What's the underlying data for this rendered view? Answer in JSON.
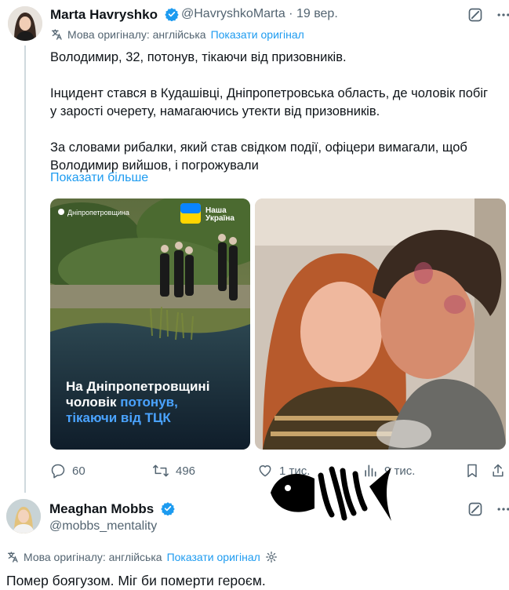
{
  "tweet1": {
    "author_name": "Marta Havryshko",
    "author_handle": "@HavryshkoMarta",
    "separator": "·",
    "date": "19 вер.",
    "translation_note": "Мова оригіналу: англійська",
    "show_original": "Показати оригінал",
    "paragraphs": [
      "Володимир, 32, потонув, тікаючи від призовників.",
      "Інцидент стався в Кудашівці, Дніпропетровська область, де чоловік побіг у зарості очерету, намагаючись утекти від призовників.",
      "За словами рибалки, який став свідком події, офіцери вимагали, щоб Володимир вийшов, і погрожували"
    ],
    "show_more": "Показати більше",
    "media1": {
      "location_label": "Дніпропетровщина",
      "badge_line1": "Наша",
      "badge_line2": "Україна",
      "headline_line1": "На Дніпропетровщині",
      "headline_line2_white": "чоловік ",
      "headline_line2_blue": "потонув,",
      "headline_line3": "тікаючи від ТЦК"
    },
    "stats": {
      "replies": "60",
      "retweets": "496",
      "likes": "1 тис.",
      "views": "9 тис."
    }
  },
  "tweet2": {
    "author_name": "Meaghan Mobbs",
    "author_handle": "@mobbs_mentality",
    "translation_note": "Мова оригіналу: англійська",
    "show_original": "Показати оригінал",
    "text": "Помер боягузом. Міг би померти героєм."
  },
  "colors": {
    "accent": "#1d9bf0",
    "secondary_text": "#536471",
    "primary_text": "#0f1419",
    "headline_blue": "#4aa3ff"
  },
  "icons": [
    "translate-icon",
    "grok-icon",
    "more-icon",
    "verified-icon",
    "reply-icon",
    "retweet-icon",
    "like-icon",
    "views-icon",
    "bookmark-icon",
    "share-icon",
    "gear-icon"
  ]
}
